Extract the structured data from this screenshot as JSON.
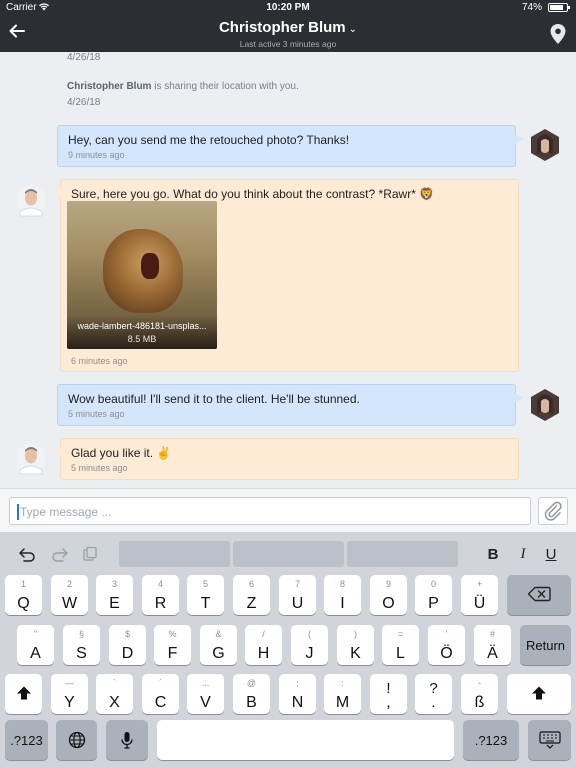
{
  "status_bar": {
    "carrier": "Carrier",
    "time": "10:20 PM",
    "battery": "74%"
  },
  "nav": {
    "title": "Christopher Blum",
    "subtitle": "Last active 3 minutes ago"
  },
  "thread": {
    "top_date": "4/26/18",
    "location_notice": {
      "name": "Christopher Blum",
      "text": " is sharing their location with you.",
      "date": "4/26/18"
    },
    "messages": [
      {
        "text": "Hey, can you send me the retouched photo? Thanks!",
        "time": "9 minutes ago"
      },
      {
        "text": "Sure, here you go. What do you think about the contrast? *Rawr* 🦁",
        "time": "6 minutes ago",
        "attachment": {
          "filename": "wade-lambert-486181-unsplas...",
          "size": "8.5 MB"
        }
      },
      {
        "text": "Wow beautiful! I'll send it to the client. He'll be stunned.",
        "time": "5 minutes ago"
      },
      {
        "text": "Glad you like it. ✌️",
        "time": "5 minutes ago"
      }
    ]
  },
  "composer": {
    "placeholder": "Type message ..."
  },
  "keyboard": {
    "format": {
      "bold": "B",
      "italic": "I",
      "underline": "U"
    },
    "row1": [
      {
        "p": "Q",
        "s": "1"
      },
      {
        "p": "W",
        "s": "2"
      },
      {
        "p": "E",
        "s": "3"
      },
      {
        "p": "R",
        "s": "4"
      },
      {
        "p": "T",
        "s": "5"
      },
      {
        "p": "Z",
        "s": "6"
      },
      {
        "p": "U",
        "s": "7"
      },
      {
        "p": "I",
        "s": "8"
      },
      {
        "p": "O",
        "s": "9"
      },
      {
        "p": "P",
        "s": "0"
      },
      {
        "p": "Ü",
        "s": "+"
      }
    ],
    "row2": [
      {
        "p": "A",
        "s": "\""
      },
      {
        "p": "S",
        "s": "§"
      },
      {
        "p": "D",
        "s": "$"
      },
      {
        "p": "F",
        "s": "%"
      },
      {
        "p": "G",
        "s": "&"
      },
      {
        "p": "H",
        "s": "/"
      },
      {
        "p": "J",
        "s": "("
      },
      {
        "p": "K",
        "s": ")"
      },
      {
        "p": "L",
        "s": "="
      },
      {
        "p": "Ö",
        "s": "'"
      },
      {
        "p": "Ä",
        "s": "#"
      }
    ],
    "row3": [
      {
        "p": "Y",
        "s": "—"
      },
      {
        "p": "X",
        "s": "`"
      },
      {
        "p": "C",
        "s": "´"
      },
      {
        "p": "V",
        "s": "..."
      },
      {
        "p": "B",
        "s": "@"
      },
      {
        "p": "N",
        "s": ";"
      },
      {
        "p": "M",
        "s": ":"
      },
      {
        "p": ",",
        "s": "!"
      },
      {
        "p": ".",
        "s": "?"
      },
      {
        "p": "ß",
        "s": "-"
      }
    ],
    "return_label": "Return",
    "numbers_label": ".?123"
  },
  "colors": {
    "nav_bg": "#2b2e33",
    "outgoing_bubble": "#d4e6fb",
    "incoming_bubble": "#fdebd5"
  },
  "icons": [
    "back-arrow-icon",
    "location-pin-icon",
    "wifi-icon",
    "battery-icon",
    "attach-paperclip-icon",
    "undo-icon",
    "redo-icon",
    "paste-icon",
    "backspace-icon",
    "shift-icon",
    "globe-icon",
    "microphone-icon",
    "keyboard-dismiss-icon"
  ]
}
